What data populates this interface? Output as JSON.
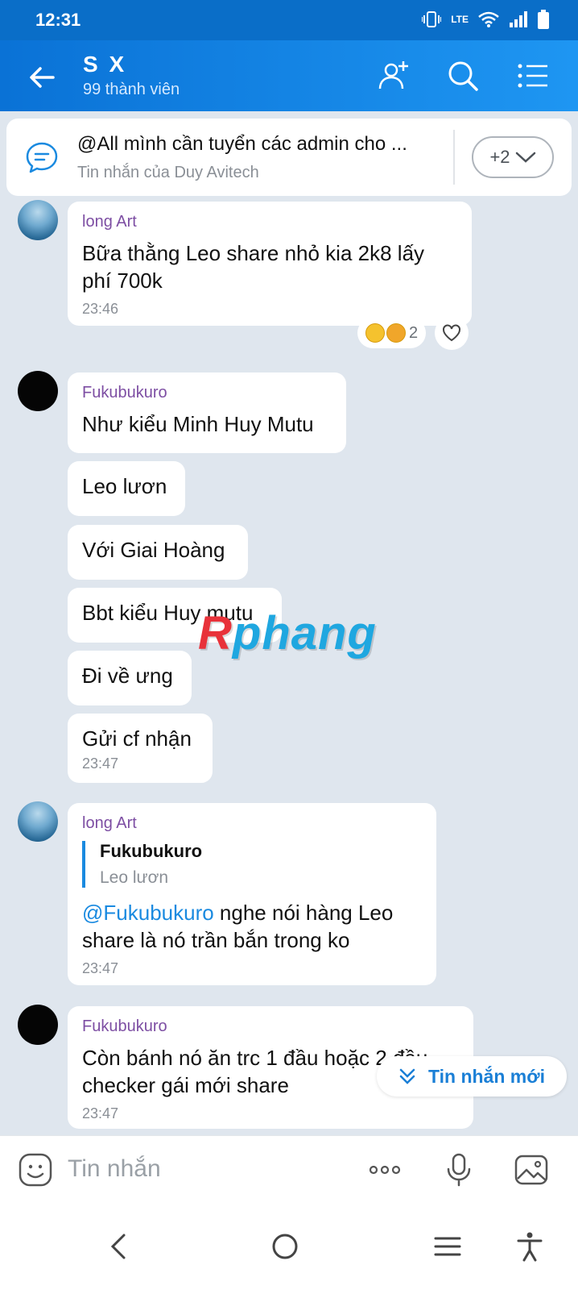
{
  "status_bar": {
    "time": "12:31",
    "network": "LTE"
  },
  "header": {
    "title": "S X",
    "subtitle": "99 thành viên"
  },
  "pinned": {
    "text": "@All mình cần tuyển các admin cho ...",
    "from": "Tin nhắn của Duy Avitech",
    "more_label": "+2"
  },
  "messages": [
    {
      "sender": "long Art",
      "text": "Bữa thằng Leo share nhỏ kia 2k8 lấy phí 700k",
      "time": "23:46",
      "reaction_count": "2"
    },
    {
      "sender": "Fukubukuro",
      "lines": [
        "Như kiểu Minh Huy Mutu",
        "Leo lươn",
        "Với Giai Hoàng",
        "Bbt kiểu Huy mutu",
        "Đi về ưng",
        "Gửi cf nhận"
      ],
      "time": "23:47"
    },
    {
      "sender": "long Art",
      "quote_name": "Fukubukuro",
      "quote_text": "Leo lươn",
      "mention": "@Fukubukuro",
      "text": " nghe nói hàng Leo share là nó trần bắn trong ko",
      "time": "23:47"
    },
    {
      "sender": "Fukubukuro",
      "text": "Còn bánh nó ăn trc 1 đầu hoặc 2 đầu checker gái mới share",
      "time": "23:47"
    }
  ],
  "new_messages_label": "Tin nhắn mới",
  "watermark": {
    "first": "R",
    "rest": "phang"
  },
  "composer": {
    "placeholder": "Tin nhắn"
  },
  "colors": {
    "header": "#0a72d6",
    "accent": "#1a8ae0",
    "sender": "#7d4ea3",
    "background": "#dfe6ee"
  }
}
